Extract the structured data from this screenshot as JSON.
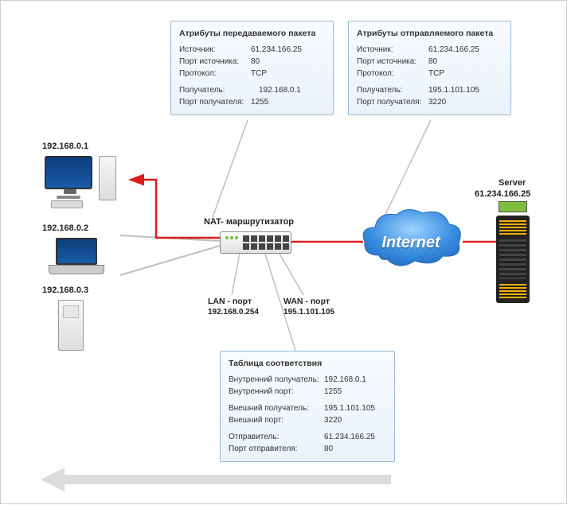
{
  "box_forward": {
    "title": "Атрибуты передаваемого пакета",
    "src_lbl": "Источник:",
    "src_val": "61.234.166.25",
    "sport_lbl": "Порт источника:",
    "sport_val": "80",
    "proto_lbl": "Протокол:",
    "proto_val": "TCP",
    "dst_lbl": "Получатель:",
    "dst_val": "192.168.0.1",
    "dport_lbl": "Порт получателя:",
    "dport_val": "1255"
  },
  "box_sent": {
    "title": "Атрибуты отправляемого пакета",
    "src_lbl": "Источник:",
    "src_val": "61.234.166.25",
    "sport_lbl": "Порт источника:",
    "sport_val": "80",
    "proto_lbl": "Протокол:",
    "proto_val": "TCP",
    "dst_lbl": "Получатель:",
    "dst_val": "195.1.101.105",
    "dport_lbl": "Порт получателя:",
    "dport_val": "3220"
  },
  "box_table": {
    "title": "Таблица соответствия",
    "ir_lbl": "Внутренний получатель:",
    "ir_val": "192.168.0.1",
    "ip_lbl": "Внутренний порт:",
    "ip_val": "1255",
    "er_lbl": "Внешний получатель:",
    "er_val": "195.1.101.105",
    "ep_lbl": "Внешний порт:",
    "ep_val": "3220",
    "sender_lbl": "Отправитель:",
    "sender_val": "61.234.166.25",
    "sp_lbl": "Порт отправителя:",
    "sp_val": "80"
  },
  "hosts": {
    "pc1": "192.168.0.1",
    "pc2": "192.168.0.2",
    "pc3": "192.168.0.3"
  },
  "nat_label": "NAT- маршрутизатор",
  "lan": {
    "label": "LAN - порт",
    "ip": "192.168.0.254"
  },
  "wan": {
    "label": "WAN - порт",
    "ip": "195.1.101.105"
  },
  "server": {
    "label": "Server",
    "ip": "61.234.166.25"
  },
  "cloud_text": "Internet"
}
